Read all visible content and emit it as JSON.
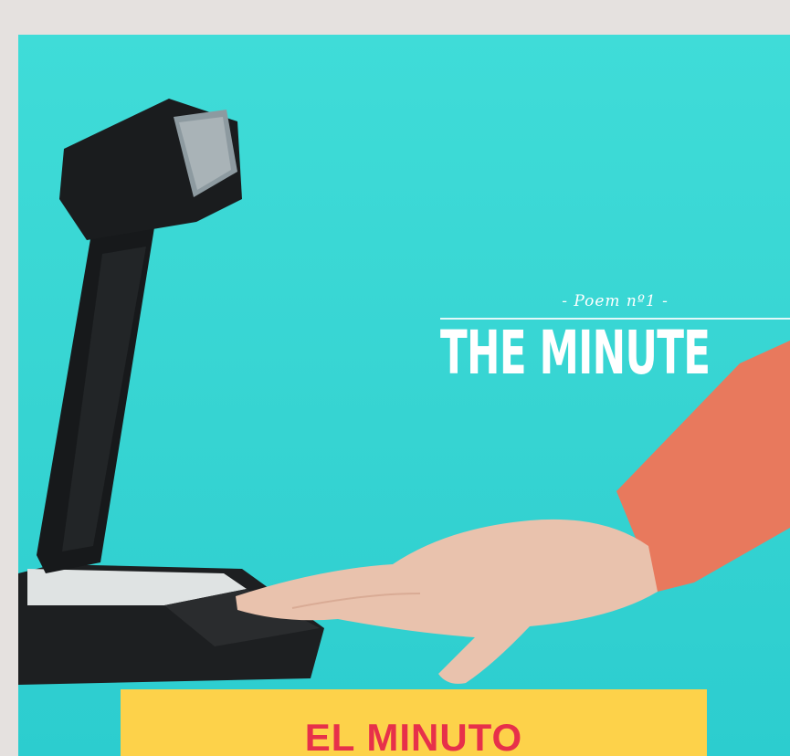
{
  "hero": {
    "overlay_subtitle": "- Poem nº1 -",
    "overlay_title": "THE MINUTE"
  },
  "banner": {
    "label": "EL MINUTO",
    "background_color": "#fdd24a",
    "text_color": "#e7304a"
  },
  "colors": {
    "page_background": "#e5e1df",
    "photo_background": "#36d4d2"
  }
}
